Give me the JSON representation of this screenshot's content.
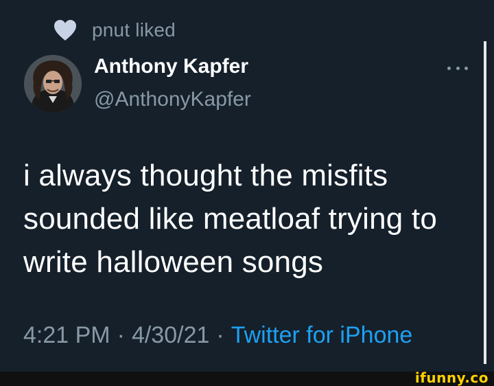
{
  "activity": {
    "icon": "heart-icon",
    "text": "pnut liked"
  },
  "author": {
    "display_name": "Anthony Kapfer",
    "handle": "@AnthonyKapfer",
    "avatar_icon": "avatar"
  },
  "more_icon": "more-icon",
  "tweet": {
    "lines": [
      "i always thought the misfits",
      "sounded like meatloaf trying to",
      "write halloween songs"
    ]
  },
  "meta": {
    "time": "4:21 PM",
    "separator": "·",
    "date": "4/30/21",
    "source": "Twitter for iPhone"
  },
  "watermark": {
    "text": "ifunny.co"
  },
  "colors": {
    "background": "#15202b",
    "text": "#ffffff",
    "muted": "#8899a6",
    "link": "#1da1f2",
    "watermark": "#ffd100"
  }
}
